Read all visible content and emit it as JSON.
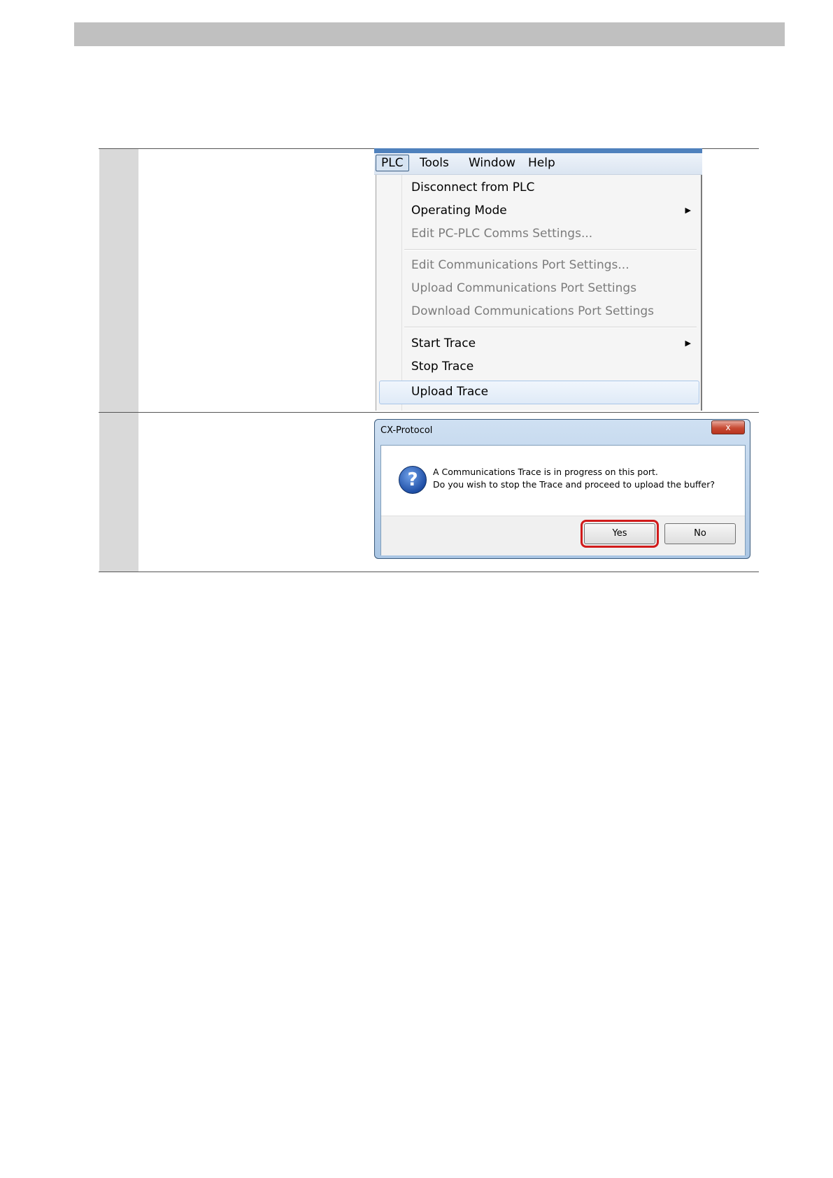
{
  "menu_screenshot": {
    "menubar": [
      "PLC",
      "Tools",
      "Window",
      "Help"
    ],
    "items": [
      {
        "label": "Disconnect from PLC",
        "disabled": false,
        "submenu": false
      },
      {
        "label": "Operating Mode",
        "disabled": false,
        "submenu": true
      },
      {
        "label": "Edit PC-PLC Comms Settings...",
        "disabled": true,
        "submenu": false
      },
      {
        "label": "Edit Communications Port Settings...",
        "disabled": true,
        "submenu": false
      },
      {
        "label": "Upload Communications Port Settings",
        "disabled": true,
        "submenu": false
      },
      {
        "label": "Download Communications Port Settings",
        "disabled": true,
        "submenu": false
      },
      {
        "label": "Start Trace",
        "disabled": false,
        "submenu": true
      },
      {
        "label": "Stop Trace",
        "disabled": false,
        "submenu": false
      },
      {
        "label": "Upload Trace",
        "disabled": false,
        "submenu": false,
        "highlighted": true
      }
    ],
    "submenu_arrow": "▶"
  },
  "dialog": {
    "title": "CX-Protocol",
    "close_glyph": "x",
    "icon": "question-icon",
    "icon_glyph": "?",
    "message_line1": "A Communications Trace is in progress on this port.",
    "message_line2": "Do you wish to stop the Trace and proceed to upload the buffer?",
    "yes_label": "Yes",
    "no_label": "No",
    "highlight_color": "#d11a1a"
  }
}
